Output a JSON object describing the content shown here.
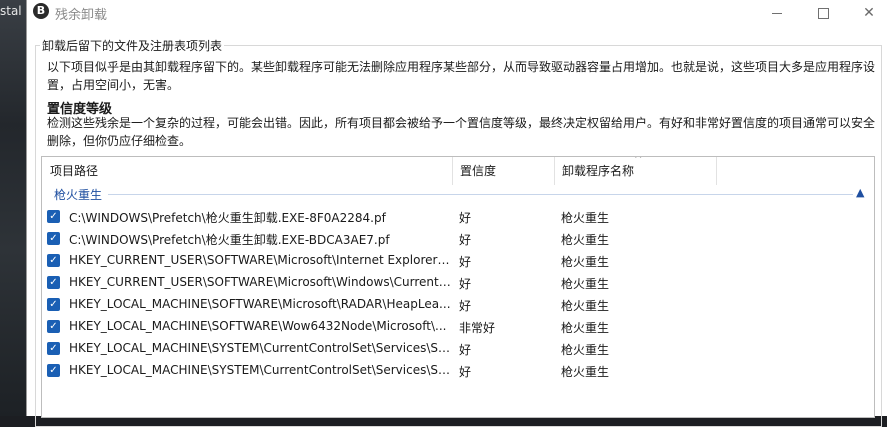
{
  "background": {
    "text": "stal"
  },
  "window": {
    "title": "残余卸载",
    "icon_letter": "B",
    "controls": [
      "minimize-icon",
      "maximize-icon",
      "close-icon"
    ]
  },
  "group_label": "卸载后留下的文件及注册表项列表",
  "description": "以下项目似乎是由其卸载程序留下的。某些卸载程序可能无法删除应用程序某些部分，从而导致驱动器容量占用增加。也就是说，这些项目大多是应用程序设置，占用空间小，无害。",
  "confidence": {
    "title": "置信度等级",
    "description": "检测这些残余是一个复杂的过程，可能会出错。因此，所有项目都会被给予一个置信度等级，最终决定权留给用户。有好和非常好置信度的项目通常可以安全删除，但你仍应仔细检查。"
  },
  "list": {
    "columns": [
      "项目路径",
      "置信度",
      "卸载程序名称"
    ],
    "group_name": "枪火重生",
    "rows": [
      {
        "checked": true,
        "path": "C:\\WINDOWS\\Prefetch\\枪火重生卸载.EXE-8F0A2284.pf",
        "confidence": "好",
        "uninstaller": "枪火重生"
      },
      {
        "checked": true,
        "path": "C:\\WINDOWS\\Prefetch\\枪火重生卸载.EXE-BDCA3AE7.pf",
        "confidence": "好",
        "uninstaller": "枪火重生"
      },
      {
        "checked": true,
        "path": "HKEY_CURRENT_USER\\SOFTWARE\\Microsoft\\Internet Explorer\\L...",
        "confidence": "好",
        "uninstaller": "枪火重生"
      },
      {
        "checked": true,
        "path": "HKEY_CURRENT_USER\\SOFTWARE\\Microsoft\\Windows\\CurrentV...",
        "confidence": "好",
        "uninstaller": "枪火重生"
      },
      {
        "checked": true,
        "path": "HKEY_LOCAL_MACHINE\\SOFTWARE\\Microsoft\\RADAR\\HeapLea...",
        "confidence": "好",
        "uninstaller": "枪火重生"
      },
      {
        "checked": true,
        "path": "HKEY_LOCAL_MACHINE\\SOFTWARE\\Wow6432Node\\Microsoft\\...",
        "confidence": "非常好",
        "uninstaller": "枪火重生"
      },
      {
        "checked": true,
        "path": "HKEY_LOCAL_MACHINE\\SYSTEM\\CurrentControlSet\\Services\\Sh...",
        "confidence": "好",
        "uninstaller": "枪火重生"
      },
      {
        "checked": true,
        "path": "HKEY_LOCAL_MACHINE\\SYSTEM\\CurrentControlSet\\Services\\Sh...",
        "confidence": "好",
        "uninstaller": "枪火重生"
      }
    ]
  },
  "colors": {
    "accent": "#1a5fb4",
    "group_text": "#1f4fa0"
  }
}
